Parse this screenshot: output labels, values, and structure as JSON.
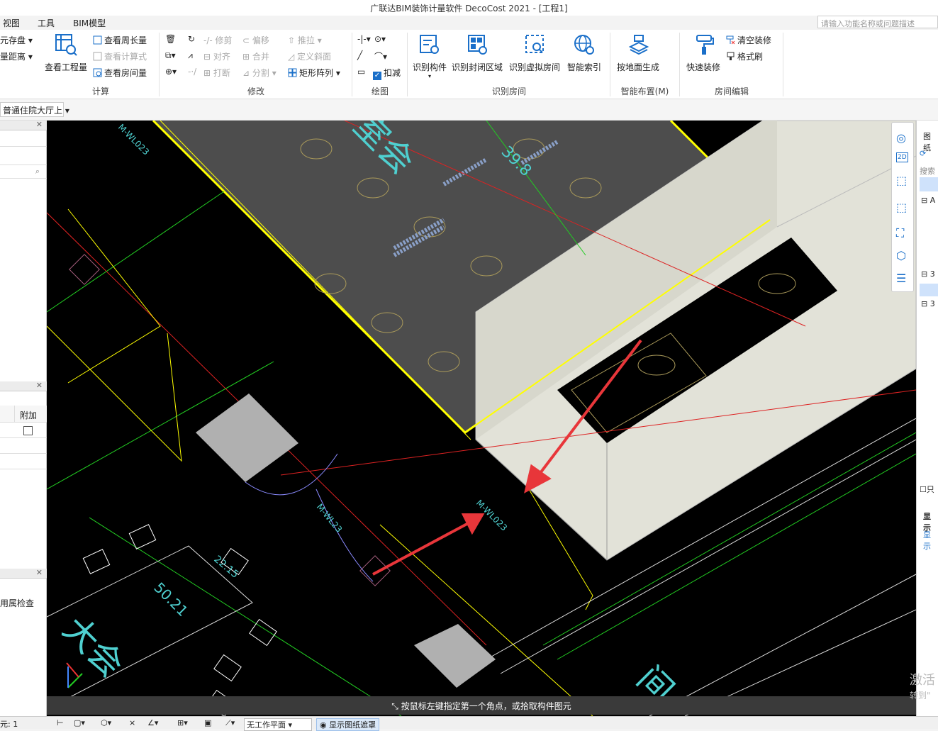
{
  "app": {
    "title": "广联达BIM装饰计量软件 DecoCost 2021 - [工程1]"
  },
  "menu": [
    "视图",
    "工具",
    "BIM模型"
  ],
  "search": {
    "placeholder": "请输入功能名称或问题描述"
  },
  "ribbon": {
    "left_partial": {
      "item1": "元存盘",
      "item2": "量距离"
    },
    "calc": {
      "label": "计算",
      "view_quantity": "查看工程量",
      "view_perimeter": "查看周长量",
      "view_formula": "查看计算式",
      "view_room": "查看房间量"
    },
    "modify": {
      "label": "修改",
      "trim": "修剪",
      "offset": "偏移",
      "extend": "推拉",
      "align": "对齐",
      "merge": "合并",
      "define_slope": "定义斜面",
      "break": "打断",
      "split": "分割",
      "rect_array": "矩形阵列"
    },
    "draw": {
      "label": "绘图",
      "deduct": "扣减"
    },
    "identify": {
      "label": "识别房间",
      "component": "识别构件",
      "closed_area": "识别封闭区域",
      "virtual_room": "识别虚拟房间",
      "smart_index": "智能索引"
    },
    "smart_layout": {
      "label": "智能布置(M)",
      "by_floor": "按地面生成"
    },
    "room_edit": {
      "label": "房间编辑",
      "quick_decor": "快速装修",
      "clear_decor": "清空装修",
      "format_brush": "格式刷"
    }
  },
  "secbar": {
    "floor_combo": "普通住院大厅上"
  },
  "left_panel": {
    "attach_header": "附加",
    "check_label": "用属检查"
  },
  "right_panel": {
    "label_drawing": "图纸",
    "label_search": "搜索",
    "label_show": "显示",
    "label_only": "只",
    "row_a": "A",
    "row_3a": "3",
    "row_3b": "3"
  },
  "viewport": {
    "status_message": "按鼠标左键指定第一个角点，或拾取构件图元",
    "cad_labels": [
      "M-WL023",
      "M-WL023",
      "M-WL23",
      "22.15",
      "39.8",
      "50.21"
    ],
    "cad_text": {
      "t1": "室会",
      "t2": "间",
      "t3": "大会"
    }
  },
  "bottom": {
    "selected_label": "元: 1",
    "workplane": "无工作平面",
    "show_drawing_mask": "显示图纸遮罩"
  },
  "watermark": {
    "line1": "激活",
    "line2": "转到\""
  },
  "colors": {
    "accent": "#1a6fc9",
    "arrow": "#e8363a",
    "cad_yellow": "#ffff00",
    "cad_green": "#22cc22",
    "cad_red": "#dd2222",
    "cad_cyan": "#4fd0d0",
    "wall": "#e2e2d8"
  }
}
